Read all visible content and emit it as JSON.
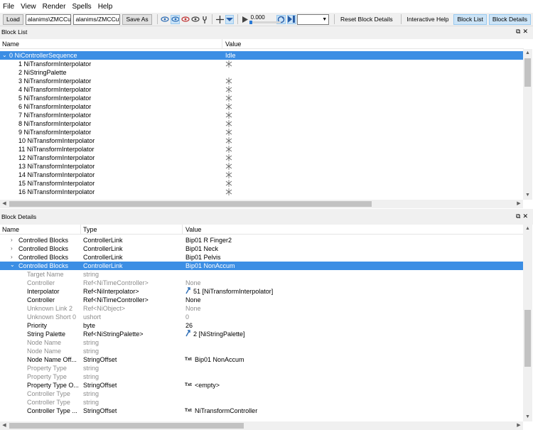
{
  "menu": [
    "File",
    "View",
    "Render",
    "Spells",
    "Help"
  ],
  "toolbar": {
    "load_label": "Load",
    "load_path": "alanims\\ZMCCuffIdle.kf",
    "save_path": "alanims/ZMCCuffIdle.kf",
    "save_as_label": "Save As",
    "time_value": "0.000",
    "reset_label": "Reset Block Details",
    "help_label": "Interactive Help",
    "block_list_label": "Block List",
    "block_details_label": "Block Details"
  },
  "block_list": {
    "title": "Block List",
    "columns": [
      "Name",
      "Value"
    ],
    "rows": [
      {
        "name": "0 NiControllerSequence",
        "value": "Idle",
        "selected": true,
        "expander": "v",
        "indent": 0
      },
      {
        "name": "1 NiTransformInterpolator",
        "value": "",
        "icon": true,
        "indent": 1
      },
      {
        "name": "2 NiStringPalette",
        "value": "",
        "icon": false,
        "indent": 1
      },
      {
        "name": "3 NiTransformInterpolator",
        "value": "",
        "icon": true,
        "indent": 1
      },
      {
        "name": "4 NiTransformInterpolator",
        "value": "",
        "icon": true,
        "indent": 1
      },
      {
        "name": "5 NiTransformInterpolator",
        "value": "",
        "icon": true,
        "indent": 1
      },
      {
        "name": "6 NiTransformInterpolator",
        "value": "",
        "icon": true,
        "indent": 1
      },
      {
        "name": "7 NiTransformInterpolator",
        "value": "",
        "icon": true,
        "indent": 1
      },
      {
        "name": "8 NiTransformInterpolator",
        "value": "",
        "icon": true,
        "indent": 1
      },
      {
        "name": "9 NiTransformInterpolator",
        "value": "",
        "icon": true,
        "indent": 1
      },
      {
        "name": "10 NiTransformInterpolator",
        "value": "",
        "icon": true,
        "indent": 1
      },
      {
        "name": "11 NiTransformInterpolator",
        "value": "",
        "icon": true,
        "indent": 1
      },
      {
        "name": "12 NiTransformInterpolator",
        "value": "",
        "icon": true,
        "indent": 1
      },
      {
        "name": "13 NiTransformInterpolator",
        "value": "",
        "icon": true,
        "indent": 1
      },
      {
        "name": "14 NiTransformInterpolator",
        "value": "",
        "icon": true,
        "indent": 1
      },
      {
        "name": "15 NiTransformInterpolator",
        "value": "",
        "icon": true,
        "indent": 1
      },
      {
        "name": "16 NiTransformInterpolator",
        "value": "",
        "icon": true,
        "indent": 1
      }
    ]
  },
  "block_details": {
    "title": "Block Details",
    "columns": [
      "Name",
      "Type",
      "Value"
    ],
    "rows": [
      {
        "name": "Controlled Blocks",
        "type": "ControllerLink",
        "value": "Bip01 R Finger2",
        "expander": ">",
        "indent": 1
      },
      {
        "name": "Controlled Blocks",
        "type": "ControllerLink",
        "value": "Bip01 Neck",
        "expander": ">",
        "indent": 1
      },
      {
        "name": "Controlled Blocks",
        "type": "ControllerLink",
        "value": "Bip01 Pelvis",
        "expander": ">",
        "indent": 1
      },
      {
        "name": "Controlled Blocks",
        "type": "ControllerLink",
        "value": "Bip01 NonAccum",
        "expander": "v",
        "indent": 1,
        "selected": true
      },
      {
        "name": "Target Name",
        "type": "string",
        "value": "",
        "indent": 2,
        "dim": true
      },
      {
        "name": "Controller",
        "type": "Ref<NiTimeController>",
        "value": "None",
        "indent": 2,
        "dim": true
      },
      {
        "name": "Interpolator",
        "type": "Ref<NiInterpolator>",
        "value": "51 [NiTransformInterpolator]",
        "indent": 2,
        "link": true
      },
      {
        "name": "Controller",
        "type": "Ref<NiTimeController>",
        "value": "None",
        "indent": 2
      },
      {
        "name": "Unknown Link 2",
        "type": "Ref<NiObject>",
        "value": "None",
        "indent": 2,
        "dim": true
      },
      {
        "name": "Unknown Short 0",
        "type": "ushort",
        "value": "0",
        "indent": 2,
        "dim": true
      },
      {
        "name": "Priority",
        "type": "byte",
        "value": "26",
        "indent": 2
      },
      {
        "name": "String Palette",
        "type": "Ref<NiStringPalette>",
        "value": "2 [NiStringPalette]",
        "indent": 2,
        "link": true
      },
      {
        "name": "Node Name",
        "type": "string",
        "value": "",
        "indent": 2,
        "dim": true
      },
      {
        "name": "Node Name",
        "type": "string",
        "value": "",
        "indent": 2,
        "dim": true
      },
      {
        "name": "Node Name Off...",
        "type": "StringOffset",
        "value": "Bip01 NonAccum",
        "indent": 2,
        "txt": true
      },
      {
        "name": "Property Type",
        "type": "string",
        "value": "",
        "indent": 2,
        "dim": true
      },
      {
        "name": "Property Type",
        "type": "string",
        "value": "",
        "indent": 2,
        "dim": true
      },
      {
        "name": "Property Type O...",
        "type": "StringOffset",
        "value": "<empty>",
        "indent": 2,
        "txt": true
      },
      {
        "name": "Controller Type",
        "type": "string",
        "value": "",
        "indent": 2,
        "dim": true
      },
      {
        "name": "Controller Type",
        "type": "string",
        "value": "",
        "indent": 2,
        "dim": true
      },
      {
        "name": "Controller Type ...",
        "type": "StringOffset",
        "value": "NiTransformController",
        "indent": 2,
        "txt": true
      }
    ]
  },
  "icons": {
    "txt_badge": "Txt",
    "float_icon": "restore-icon",
    "close_icon": "close-icon"
  },
  "colors": {
    "selection": "#3c8ee4",
    "dim_text": "#8c8c8c"
  }
}
